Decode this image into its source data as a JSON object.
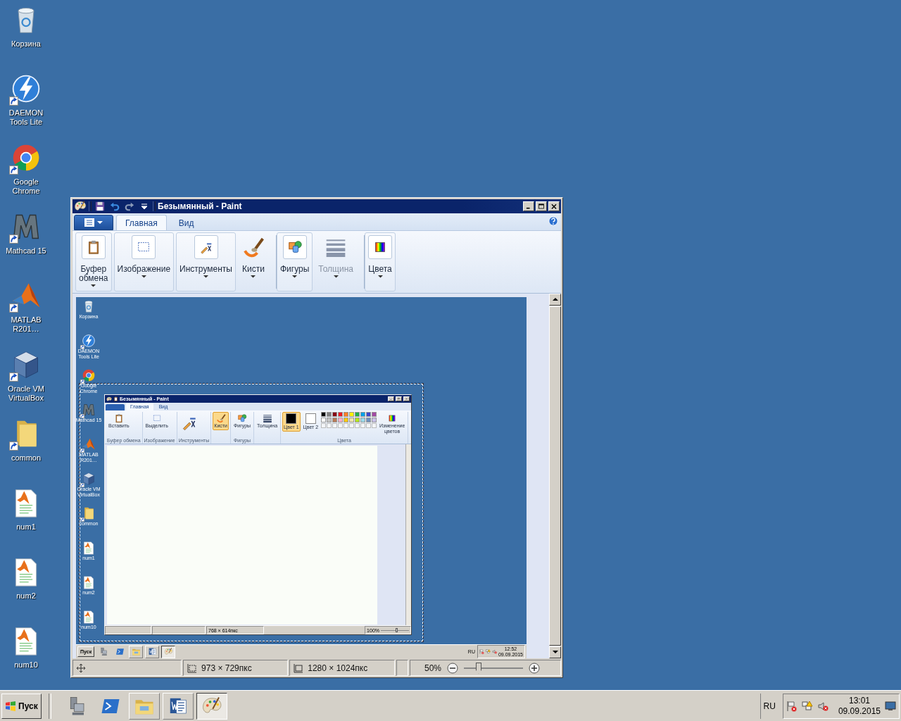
{
  "desktop": {
    "icons": [
      {
        "label": "Корзина",
        "kind": "recycle",
        "shortcut": false
      },
      {
        "label": "DAEMON Tools Lite",
        "kind": "daemon",
        "shortcut": true
      },
      {
        "label": "Google Chrome",
        "kind": "chrome",
        "shortcut": true
      },
      {
        "label": "Mathcad 15",
        "kind": "mathcad",
        "shortcut": true
      },
      {
        "label": "MATLAB R201…",
        "kind": "matlab",
        "shortcut": true
      },
      {
        "label": "Oracle VM VirtualBox",
        "kind": "virtualbox",
        "shortcut": true
      },
      {
        "label": "common",
        "kind": "folder",
        "shortcut": true
      },
      {
        "label": "num1",
        "kind": "mfile",
        "shortcut": false
      },
      {
        "label": "num2",
        "kind": "mfile",
        "shortcut": false
      },
      {
        "label": "num10",
        "kind": "mfile",
        "shortcut": false
      }
    ]
  },
  "paint_window": {
    "title": "Безымянный - Paint",
    "tabs": [
      {
        "label": "Главная",
        "selected": true
      },
      {
        "label": "Вид",
        "selected": false
      }
    ],
    "ribbon": [
      {
        "label": "Буфер обмена",
        "kind": "clipboard",
        "framed": true,
        "disabled": false,
        "separator_before": false
      },
      {
        "label": "Изображение",
        "kind": "select",
        "framed": true,
        "disabled": false,
        "separator_before": false
      },
      {
        "label": "Инструменты",
        "kind": "tools",
        "framed": true,
        "disabled": false,
        "separator_before": false
      },
      {
        "label": "Кисти",
        "kind": "brush",
        "framed": false,
        "disabled": false,
        "separator_before": false
      },
      {
        "label": "Фигуры",
        "kind": "shapes",
        "framed": true,
        "disabled": false,
        "separator_before": true
      },
      {
        "label": "Толщина",
        "kind": "width",
        "framed": false,
        "disabled": true,
        "separator_before": false
      },
      {
        "label": "Цвета",
        "kind": "colors",
        "framed": true,
        "disabled": false,
        "separator_before": true
      }
    ],
    "canvas": {
      "screenshot": {
        "desktop_icons": [
          {
            "label": "Корзина",
            "kind": "recycle",
            "shortcut": false
          },
          {
            "label": "DAEMON Tools Lite",
            "kind": "daemon",
            "shortcut": true
          },
          {
            "label": "Google Chrome",
            "kind": "chrome",
            "shortcut": true
          },
          {
            "label": "Mathcad 15",
            "kind": "mathcad",
            "shortcut": true
          },
          {
            "label": "MATLAB R201…",
            "kind": "matlab",
            "shortcut": true
          },
          {
            "label": "Oracle VM VirtualBox",
            "kind": "virtualbox",
            "shortcut": true
          },
          {
            "label": "common",
            "kind": "folder",
            "shortcut": true
          },
          {
            "label": "num1",
            "kind": "mfile",
            "shortcut": false
          },
          {
            "label": "num2",
            "kind": "mfile",
            "shortcut": false
          },
          {
            "label": "num10",
            "kind": "mfile",
            "shortcut": false
          }
        ],
        "paint_window": {
          "title": "Безымянный - Paint",
          "tabs": [
            {
              "label": "Главная",
              "selected": true
            },
            {
              "label": "Вид",
              "selected": false
            }
          ],
          "groups": [
            {
              "label": "Буфер обмена",
              "buttons": [
                {
                  "kind": "paste",
                  "label": "Вставить",
                  "selected": false
                }
              ]
            },
            {
              "label": "Изображение",
              "buttons": [
                {
                  "kind": "select",
                  "label": "Выделить",
                  "selected": false
                }
              ]
            },
            {
              "label": "Инструменты",
              "buttons": [
                {
                  "kind": "tools",
                  "selected": false
                }
              ]
            },
            {
              "buttons": [
                {
                  "kind": "brush",
                  "label": "Кисти",
                  "selected": true
                }
              ]
            },
            {
              "label": "Фигуры",
              "buttons": [
                {
                  "kind": "shapes",
                  "label": "Фигуры",
                  "selected": false
                }
              ]
            },
            {
              "buttons": [
                {
                  "kind": "width",
                  "label": "Толщина",
                  "selected": false
                }
              ]
            },
            {
              "label": "Цвета",
              "buttons": [
                {
                  "kind": "color",
                  "label": "Цвет 1",
                  "color": "#000000",
                  "selected": true
                },
                {
                  "kind": "color",
                  "label": "Цвет 2",
                  "color": "#ffffff",
                  "selected": false
                },
                {
                  "kind": "palette"
                },
                {
                  "kind": "edit",
                  "label": "Изменение цветов",
                  "selected": false
                }
              ]
            }
          ],
          "palette": [
            {
              "color": "#000000"
            },
            {
              "color": "#7f7f7f"
            },
            {
              "color": "#880015"
            },
            {
              "color": "#ed1c24"
            },
            {
              "color": "#ff7f27"
            },
            {
              "color": "#fff200"
            },
            {
              "color": "#22b14c"
            },
            {
              "color": "#00a2e8"
            },
            {
              "color": "#3f48cc"
            },
            {
              "color": "#a349a4"
            },
            {
              "color": "#ffffff"
            },
            {
              "color": "#c3c3c3"
            },
            {
              "color": "#b97a57"
            },
            {
              "color": "#ffaec9"
            },
            {
              "color": "#ffc90e"
            },
            {
              "color": "#efe4b0"
            },
            {
              "color": "#b5e61d"
            },
            {
              "color": "#99d9ea"
            },
            {
              "color": "#7092be"
            },
            {
              "color": "#c8bfe7"
            }
          ],
          "status_bar": {
            "image_size": "768 × 614пкс",
            "zoom": "100%",
            "zoom_slider": {
              "level": 0.55
            }
          }
        },
        "taskbar": {
          "start": "Пуск",
          "apps": [
            {
              "kind": "server",
              "open": false,
              "active": false
            },
            {
              "kind": "powershell",
              "open": false,
              "active": false
            },
            {
              "kind": "explorer",
              "open": true,
              "active": false
            },
            {
              "kind": "word",
              "open": true,
              "active": false
            },
            {
              "kind": "paint",
              "open": true,
              "active": true
            }
          ],
          "language": "RU",
          "time": "12:52",
          "date": "09.09.2015"
        }
      }
    },
    "status_bar": {
      "selection_size": "973 × 729пкс",
      "image_size": "1280 × 1024пкс",
      "zoom": "50%",
      "zoom_slider": {
        "level": 0.25
      }
    }
  },
  "taskbar": {
    "start": "Пуск",
    "apps": [
      {
        "kind": "server",
        "open": false,
        "active": false
      },
      {
        "kind": "powershell",
        "open": false,
        "active": false
      },
      {
        "kind": "explorer",
        "open": true,
        "active": false
      },
      {
        "kind": "word",
        "open": true,
        "active": false
      },
      {
        "kind": "paint",
        "open": true,
        "active": true
      }
    ],
    "language": "RU",
    "time": "13:01",
    "date": "09.09.2015"
  }
}
